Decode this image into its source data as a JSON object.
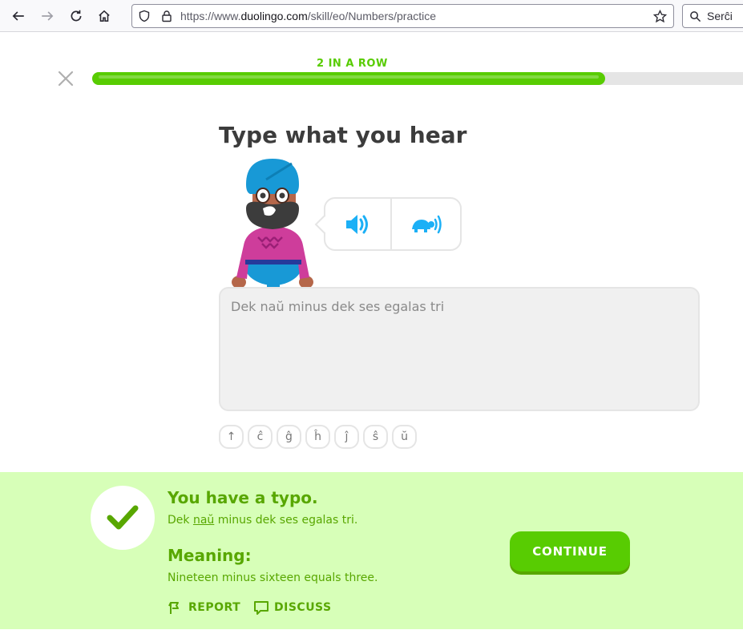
{
  "browser": {
    "url_prefix": "https://www.",
    "url_host": "duolingo.com",
    "url_path": "/skill/eo/Numbers/practice",
    "search_placeholder": "Serĉi"
  },
  "lesson": {
    "streak_label": "2 IN A ROW",
    "progress_fraction": 0.78,
    "prompt_title": "Type what you hear",
    "answer_text": "Dek naŭ minus dek ses egalas tri",
    "special_keys": [
      "↑",
      "ĉ",
      "ĝ",
      "ĥ",
      "ĵ",
      "ŝ",
      "ŭ"
    ]
  },
  "feedback": {
    "title": "You have a typo.",
    "correction_before": "Dek ",
    "correction_typo": "naŭ",
    "correction_after": " minus dek ses egalas tri.",
    "meaning_title": "Meaning:",
    "meaning_text": "Nineteen minus sixteen equals three.",
    "report_label": "REPORT",
    "discuss_label": "DISCUSS",
    "continue_label": "CONTINUE"
  },
  "colors": {
    "accent_green": "#58cc02",
    "dark_green": "#58a700",
    "feedback_bg": "#d7ffb8",
    "audio_blue": "#1cb0f6"
  }
}
